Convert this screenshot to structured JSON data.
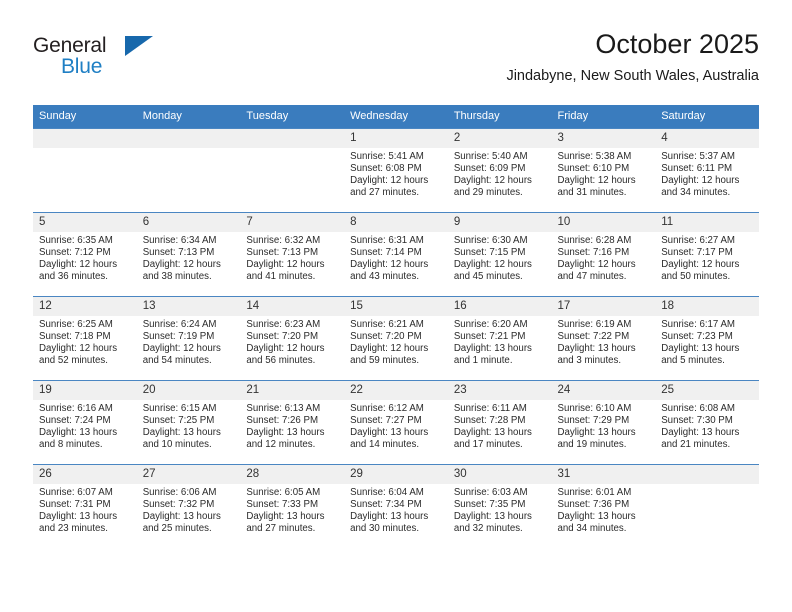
{
  "brand": {
    "line1": "General",
    "line2": "Blue",
    "triangle_color": "#1768ac",
    "blue_color": "#1f7fc4"
  },
  "header": {
    "title": "October 2025",
    "subtitle": "Jindabyne, New South Wales, Australia"
  },
  "theme": {
    "header_blue": "#3a7cbe",
    "daynum_bg": "#f0f0f0",
    "text": "#2b2b2b"
  },
  "weekday_headers": [
    "Sunday",
    "Monday",
    "Tuesday",
    "Wednesday",
    "Thursday",
    "Friday",
    "Saturday"
  ],
  "weeks": [
    [
      {
        "day": "",
        "sunrise": "",
        "sunset": "",
        "daylight1": "",
        "daylight2": "",
        "empty": true
      },
      {
        "day": "",
        "sunrise": "",
        "sunset": "",
        "daylight1": "",
        "daylight2": "",
        "empty": true
      },
      {
        "day": "",
        "sunrise": "",
        "sunset": "",
        "daylight1": "",
        "daylight2": "",
        "empty": true
      },
      {
        "day": "1",
        "sunrise": "Sunrise: 5:41 AM",
        "sunset": "Sunset: 6:08 PM",
        "daylight1": "Daylight: 12 hours",
        "daylight2": "and 27 minutes.",
        "empty": false
      },
      {
        "day": "2",
        "sunrise": "Sunrise: 5:40 AM",
        "sunset": "Sunset: 6:09 PM",
        "daylight1": "Daylight: 12 hours",
        "daylight2": "and 29 minutes.",
        "empty": false
      },
      {
        "day": "3",
        "sunrise": "Sunrise: 5:38 AM",
        "sunset": "Sunset: 6:10 PM",
        "daylight1": "Daylight: 12 hours",
        "daylight2": "and 31 minutes.",
        "empty": false
      },
      {
        "day": "4",
        "sunrise": "Sunrise: 5:37 AM",
        "sunset": "Sunset: 6:11 PM",
        "daylight1": "Daylight: 12 hours",
        "daylight2": "and 34 minutes.",
        "empty": false
      }
    ],
    [
      {
        "day": "5",
        "sunrise": "Sunrise: 6:35 AM",
        "sunset": "Sunset: 7:12 PM",
        "daylight1": "Daylight: 12 hours",
        "daylight2": "and 36 minutes.",
        "empty": false
      },
      {
        "day": "6",
        "sunrise": "Sunrise: 6:34 AM",
        "sunset": "Sunset: 7:13 PM",
        "daylight1": "Daylight: 12 hours",
        "daylight2": "and 38 minutes.",
        "empty": false
      },
      {
        "day": "7",
        "sunrise": "Sunrise: 6:32 AM",
        "sunset": "Sunset: 7:13 PM",
        "daylight1": "Daylight: 12 hours",
        "daylight2": "and 41 minutes.",
        "empty": false
      },
      {
        "day": "8",
        "sunrise": "Sunrise: 6:31 AM",
        "sunset": "Sunset: 7:14 PM",
        "daylight1": "Daylight: 12 hours",
        "daylight2": "and 43 minutes.",
        "empty": false
      },
      {
        "day": "9",
        "sunrise": "Sunrise: 6:30 AM",
        "sunset": "Sunset: 7:15 PM",
        "daylight1": "Daylight: 12 hours",
        "daylight2": "and 45 minutes.",
        "empty": false
      },
      {
        "day": "10",
        "sunrise": "Sunrise: 6:28 AM",
        "sunset": "Sunset: 7:16 PM",
        "daylight1": "Daylight: 12 hours",
        "daylight2": "and 47 minutes.",
        "empty": false
      },
      {
        "day": "11",
        "sunrise": "Sunrise: 6:27 AM",
        "sunset": "Sunset: 7:17 PM",
        "daylight1": "Daylight: 12 hours",
        "daylight2": "and 50 minutes.",
        "empty": false
      }
    ],
    [
      {
        "day": "12",
        "sunrise": "Sunrise: 6:25 AM",
        "sunset": "Sunset: 7:18 PM",
        "daylight1": "Daylight: 12 hours",
        "daylight2": "and 52 minutes.",
        "empty": false
      },
      {
        "day": "13",
        "sunrise": "Sunrise: 6:24 AM",
        "sunset": "Sunset: 7:19 PM",
        "daylight1": "Daylight: 12 hours",
        "daylight2": "and 54 minutes.",
        "empty": false
      },
      {
        "day": "14",
        "sunrise": "Sunrise: 6:23 AM",
        "sunset": "Sunset: 7:20 PM",
        "daylight1": "Daylight: 12 hours",
        "daylight2": "and 56 minutes.",
        "empty": false
      },
      {
        "day": "15",
        "sunrise": "Sunrise: 6:21 AM",
        "sunset": "Sunset: 7:20 PM",
        "daylight1": "Daylight: 12 hours",
        "daylight2": "and 59 minutes.",
        "empty": false
      },
      {
        "day": "16",
        "sunrise": "Sunrise: 6:20 AM",
        "sunset": "Sunset: 7:21 PM",
        "daylight1": "Daylight: 13 hours",
        "daylight2": "and 1 minute.",
        "empty": false
      },
      {
        "day": "17",
        "sunrise": "Sunrise: 6:19 AM",
        "sunset": "Sunset: 7:22 PM",
        "daylight1": "Daylight: 13 hours",
        "daylight2": "and 3 minutes.",
        "empty": false
      },
      {
        "day": "18",
        "sunrise": "Sunrise: 6:17 AM",
        "sunset": "Sunset: 7:23 PM",
        "daylight1": "Daylight: 13 hours",
        "daylight2": "and 5 minutes.",
        "empty": false
      }
    ],
    [
      {
        "day": "19",
        "sunrise": "Sunrise: 6:16 AM",
        "sunset": "Sunset: 7:24 PM",
        "daylight1": "Daylight: 13 hours",
        "daylight2": "and 8 minutes.",
        "empty": false
      },
      {
        "day": "20",
        "sunrise": "Sunrise: 6:15 AM",
        "sunset": "Sunset: 7:25 PM",
        "daylight1": "Daylight: 13 hours",
        "daylight2": "and 10 minutes.",
        "empty": false
      },
      {
        "day": "21",
        "sunrise": "Sunrise: 6:13 AM",
        "sunset": "Sunset: 7:26 PM",
        "daylight1": "Daylight: 13 hours",
        "daylight2": "and 12 minutes.",
        "empty": false
      },
      {
        "day": "22",
        "sunrise": "Sunrise: 6:12 AM",
        "sunset": "Sunset: 7:27 PM",
        "daylight1": "Daylight: 13 hours",
        "daylight2": "and 14 minutes.",
        "empty": false
      },
      {
        "day": "23",
        "sunrise": "Sunrise: 6:11 AM",
        "sunset": "Sunset: 7:28 PM",
        "daylight1": "Daylight: 13 hours",
        "daylight2": "and 17 minutes.",
        "empty": false
      },
      {
        "day": "24",
        "sunrise": "Sunrise: 6:10 AM",
        "sunset": "Sunset: 7:29 PM",
        "daylight1": "Daylight: 13 hours",
        "daylight2": "and 19 minutes.",
        "empty": false
      },
      {
        "day": "25",
        "sunrise": "Sunrise: 6:08 AM",
        "sunset": "Sunset: 7:30 PM",
        "daylight1": "Daylight: 13 hours",
        "daylight2": "and 21 minutes.",
        "empty": false
      }
    ],
    [
      {
        "day": "26",
        "sunrise": "Sunrise: 6:07 AM",
        "sunset": "Sunset: 7:31 PM",
        "daylight1": "Daylight: 13 hours",
        "daylight2": "and 23 minutes.",
        "empty": false
      },
      {
        "day": "27",
        "sunrise": "Sunrise: 6:06 AM",
        "sunset": "Sunset: 7:32 PM",
        "daylight1": "Daylight: 13 hours",
        "daylight2": "and 25 minutes.",
        "empty": false
      },
      {
        "day": "28",
        "sunrise": "Sunrise: 6:05 AM",
        "sunset": "Sunset: 7:33 PM",
        "daylight1": "Daylight: 13 hours",
        "daylight2": "and 27 minutes.",
        "empty": false
      },
      {
        "day": "29",
        "sunrise": "Sunrise: 6:04 AM",
        "sunset": "Sunset: 7:34 PM",
        "daylight1": "Daylight: 13 hours",
        "daylight2": "and 30 minutes.",
        "empty": false
      },
      {
        "day": "30",
        "sunrise": "Sunrise: 6:03 AM",
        "sunset": "Sunset: 7:35 PM",
        "daylight1": "Daylight: 13 hours",
        "daylight2": "and 32 minutes.",
        "empty": false
      },
      {
        "day": "31",
        "sunrise": "Sunrise: 6:01 AM",
        "sunset": "Sunset: 7:36 PM",
        "daylight1": "Daylight: 13 hours",
        "daylight2": "and 34 minutes.",
        "empty": false
      },
      {
        "day": "",
        "sunrise": "",
        "sunset": "",
        "daylight1": "",
        "daylight2": "",
        "empty": true
      }
    ]
  ]
}
